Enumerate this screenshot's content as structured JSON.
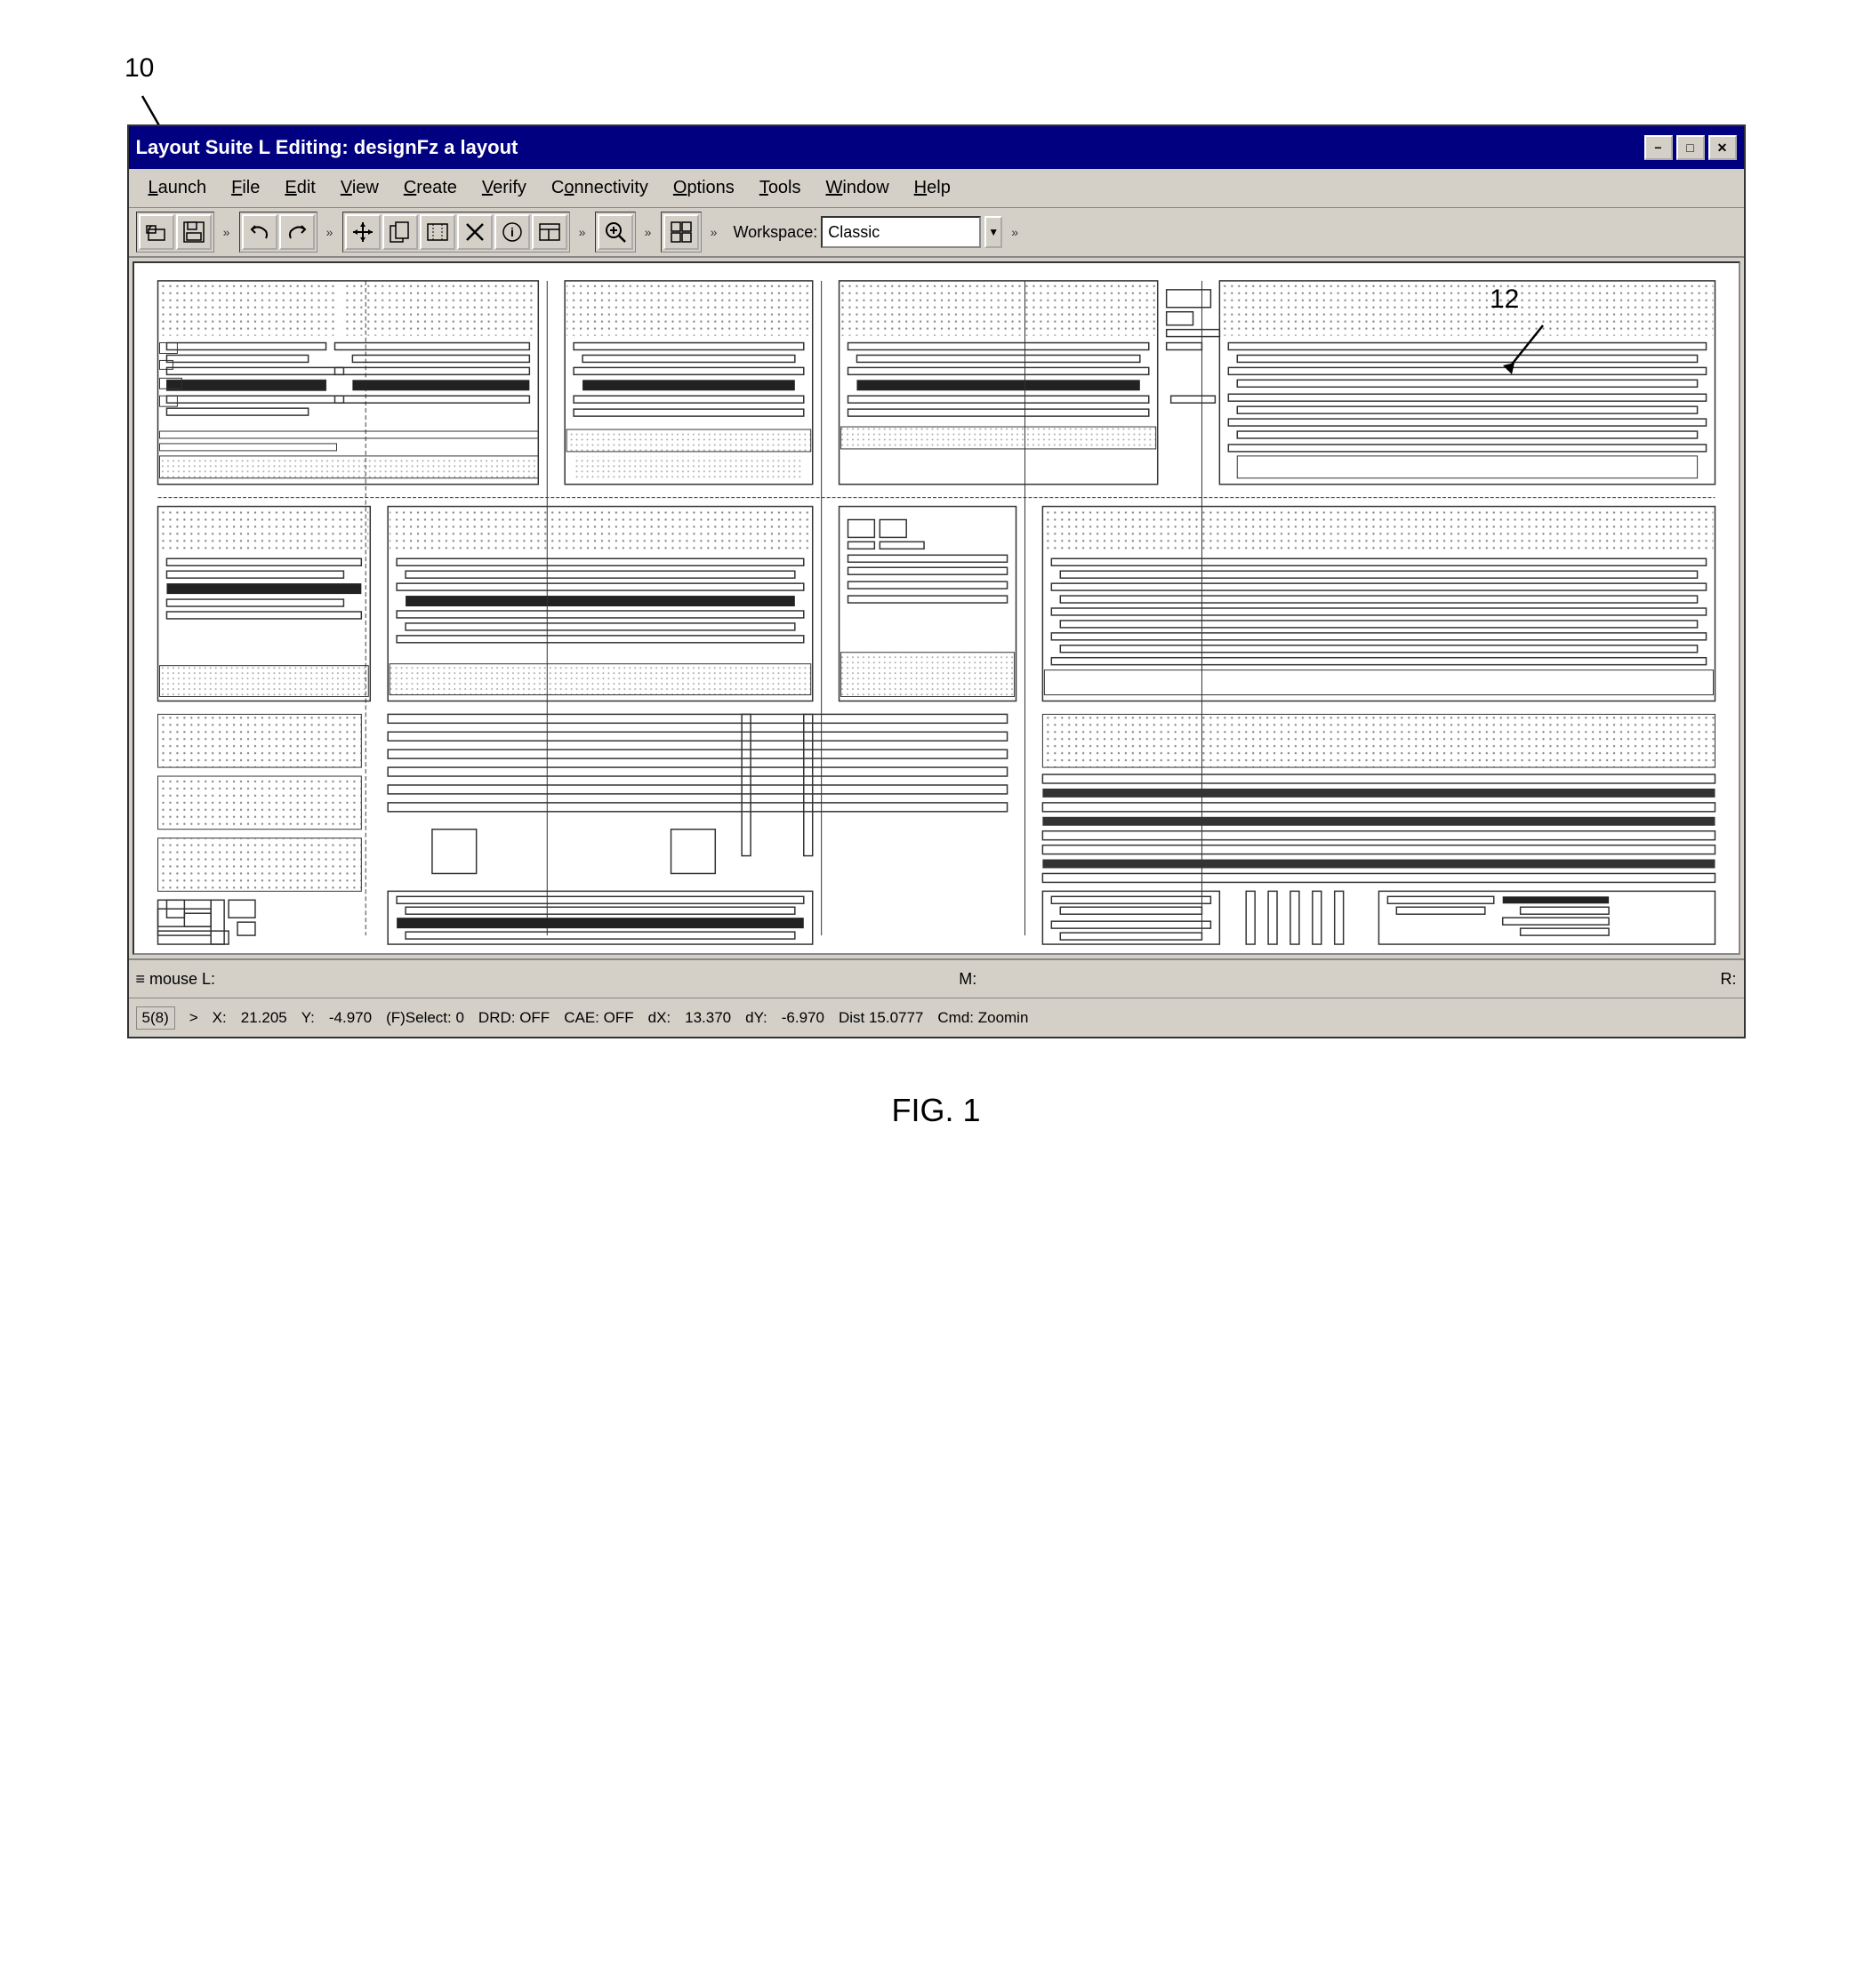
{
  "figure": {
    "reference_number": "10",
    "fig_label": "FIG. 1",
    "label_12": "12"
  },
  "window": {
    "title": "Layout Suite L Editing: designFz a layout",
    "controls": {
      "minimize": "−",
      "maximize": "□",
      "close": "✕"
    }
  },
  "menu": {
    "items": [
      {
        "label": "Launch",
        "underline": "L"
      },
      {
        "label": "File",
        "underline": "F"
      },
      {
        "label": "Edit",
        "underline": "E"
      },
      {
        "label": "View",
        "underline": "V"
      },
      {
        "label": "Create",
        "underline": "C"
      },
      {
        "label": "Verify",
        "underline": "V"
      },
      {
        "label": "Connectivity",
        "underline": "C"
      },
      {
        "label": "Options",
        "underline": "O"
      },
      {
        "label": "Tools",
        "underline": "T"
      },
      {
        "label": "Window",
        "underline": "W"
      },
      {
        "label": "Help",
        "underline": "H"
      }
    ]
  },
  "toolbar": {
    "workspace_label": "Workspace:",
    "workspace_value": "Classic"
  },
  "status_bar": {
    "mouse_label": "≡ mouse L:",
    "m_label": "M:",
    "r_label": "R:"
  },
  "info_bar": {
    "layer": "5(8)",
    "prompt": ">",
    "x_label": "X:",
    "x_value": "21.205",
    "y_label": "Y:",
    "y_value": "-4.970",
    "f_select": "(F)Select: 0",
    "drd": "DRD: OFF",
    "cae": "CAE: OFF",
    "dx_label": "dX:",
    "dx_value": "13.370",
    "dy_label": "dY:",
    "dy_value": "-6.970",
    "dist": "Dist 15.0777",
    "cmd": "Cmd: Zoomin"
  }
}
